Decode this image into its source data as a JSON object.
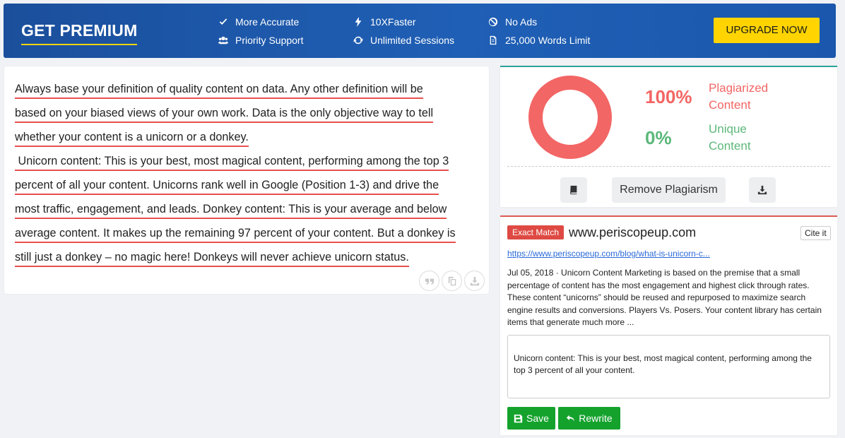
{
  "banner": {
    "title": "GET PREMIUM",
    "features": {
      "more_accurate": "More Accurate",
      "priority_support": "Priority Support",
      "faster": "10XFaster",
      "unlimited_sessions": "Unlimited Sessions",
      "no_ads": "No Ads",
      "words_limit": "25,000 Words Limit"
    },
    "upgrade_label": "UPGRADE NOW",
    "colors": {
      "background": "#1f5fb5",
      "accent": "#ffd400"
    }
  },
  "text_panel": {
    "lines": [
      "Always base your definition of quality content on data. Any other definition will be",
      "based on your biased views of your own work. Data is the only objective way to tell",
      "whether your content is a unicorn or a donkey.",
      " Unicorn content: This is your best, most magical content, performing among the top 3",
      "percent of all your content. Unicorns rank well in Google (Position 1-3) and drive the",
      "most traffic, engagement, and leads. Donkey content: This is your average and below",
      "average content. It makes up the remaining 97 percent of your content. But a donkey is",
      "still just a donkey – no magic here! Donkeys will never achieve unicorn status."
    ],
    "tool_icons": [
      "quote-icon",
      "copy-icon",
      "download-icon"
    ]
  },
  "result": {
    "plagiarized_pct": "100%",
    "plagiarized_label_1": "Plagiarized",
    "plagiarized_label_2": "Content",
    "unique_pct": "0%",
    "unique_label_1": "Unique",
    "unique_label_2": "Content",
    "remove_label": "Remove Plagiarism",
    "plagiarized_fraction": 1.0,
    "colors": {
      "plagiarized": "#f26665",
      "unique": "#5cb87a"
    }
  },
  "source": {
    "badge": "Exact Match",
    "domain": "www.periscopeup.com",
    "cite_label": "Cite it",
    "url": "https://www.periscopeup.com/blog/what-is-unicorn-c...",
    "snippet": "Jul 05, 2018 · Unicorn Content Marketing is based on the premise that a small percentage of content has the most engagement and highest click through rates. These content “unicorns” should be reused and repurposed to maximize search engine results and conversions. Players Vs. Posers. Your content library has certain items that generate much more ...",
    "matched_text": "Unicorn content: This is your best, most magical content, performing among the top 3 percent of all your content.",
    "save_label": "Save",
    "rewrite_label": "Rewrite"
  }
}
